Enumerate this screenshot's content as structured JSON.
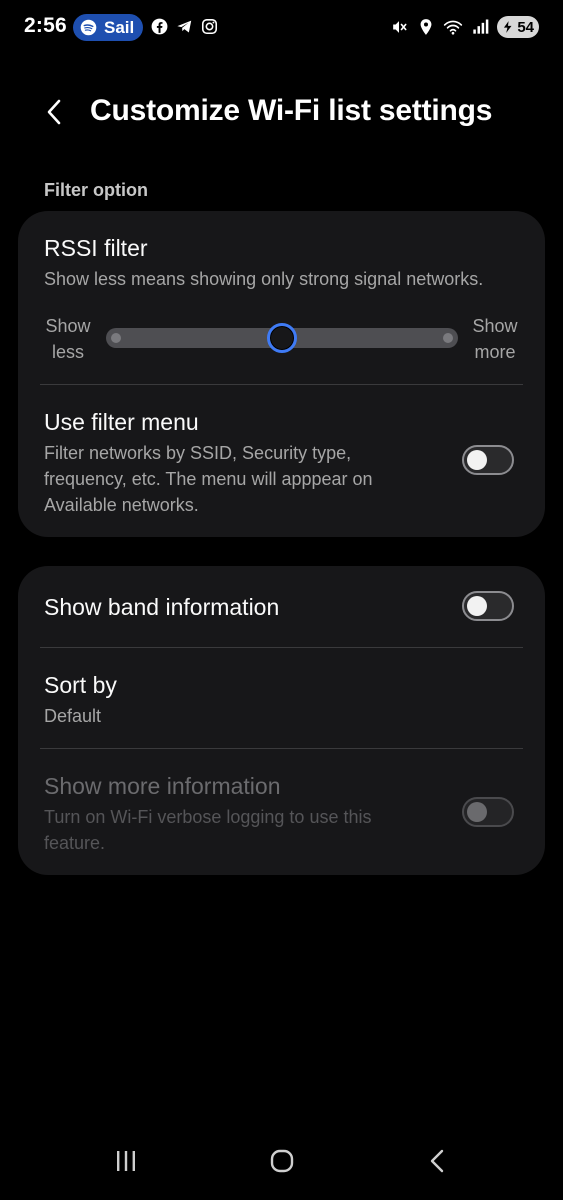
{
  "status_bar": {
    "time": "2:56",
    "spotify_pill": "Sail",
    "battery": "54",
    "notification_icons": [
      "facebook-icon",
      "telegram-icon",
      "instagram-icon"
    ],
    "system_icons": [
      "mute-icon",
      "location-icon",
      "wifi-icon",
      "signal-icon",
      "battery-icon"
    ]
  },
  "header": {
    "title": "Customize Wi-Fi list settings"
  },
  "section": {
    "filter_label": "Filter option"
  },
  "rssi": {
    "title": "RSSI filter",
    "subtitle": "Show less means showing only strong signal networks.",
    "less_label_1": "Show",
    "less_label_2": "less",
    "more_label_1": "Show",
    "more_label_2": "more",
    "slider_level": 0.5
  },
  "filter_menu": {
    "title": "Use filter menu",
    "subtitle_1": "Filter networks by SSID, Security type,",
    "subtitle_2": "frequency, etc. The menu will apppear on",
    "subtitle_3": "Available networks.",
    "enabled": false
  },
  "band_info": {
    "title": "Show band information",
    "enabled": false
  },
  "sort_by": {
    "title": "Sort by",
    "value": "Default"
  },
  "more_info": {
    "title": "Show more information",
    "subtitle_1": "Turn on Wi-Fi verbose logging to use this",
    "subtitle_2": "feature.",
    "enabled": false,
    "disabled": true
  },
  "colors": {
    "background": "#000000",
    "card": "#171719",
    "accent": "#3f7bf5",
    "spotify_pill": "#1e4fb0"
  },
  "navbar": {
    "buttons": [
      "recents-icon",
      "home-icon",
      "back-icon"
    ]
  }
}
